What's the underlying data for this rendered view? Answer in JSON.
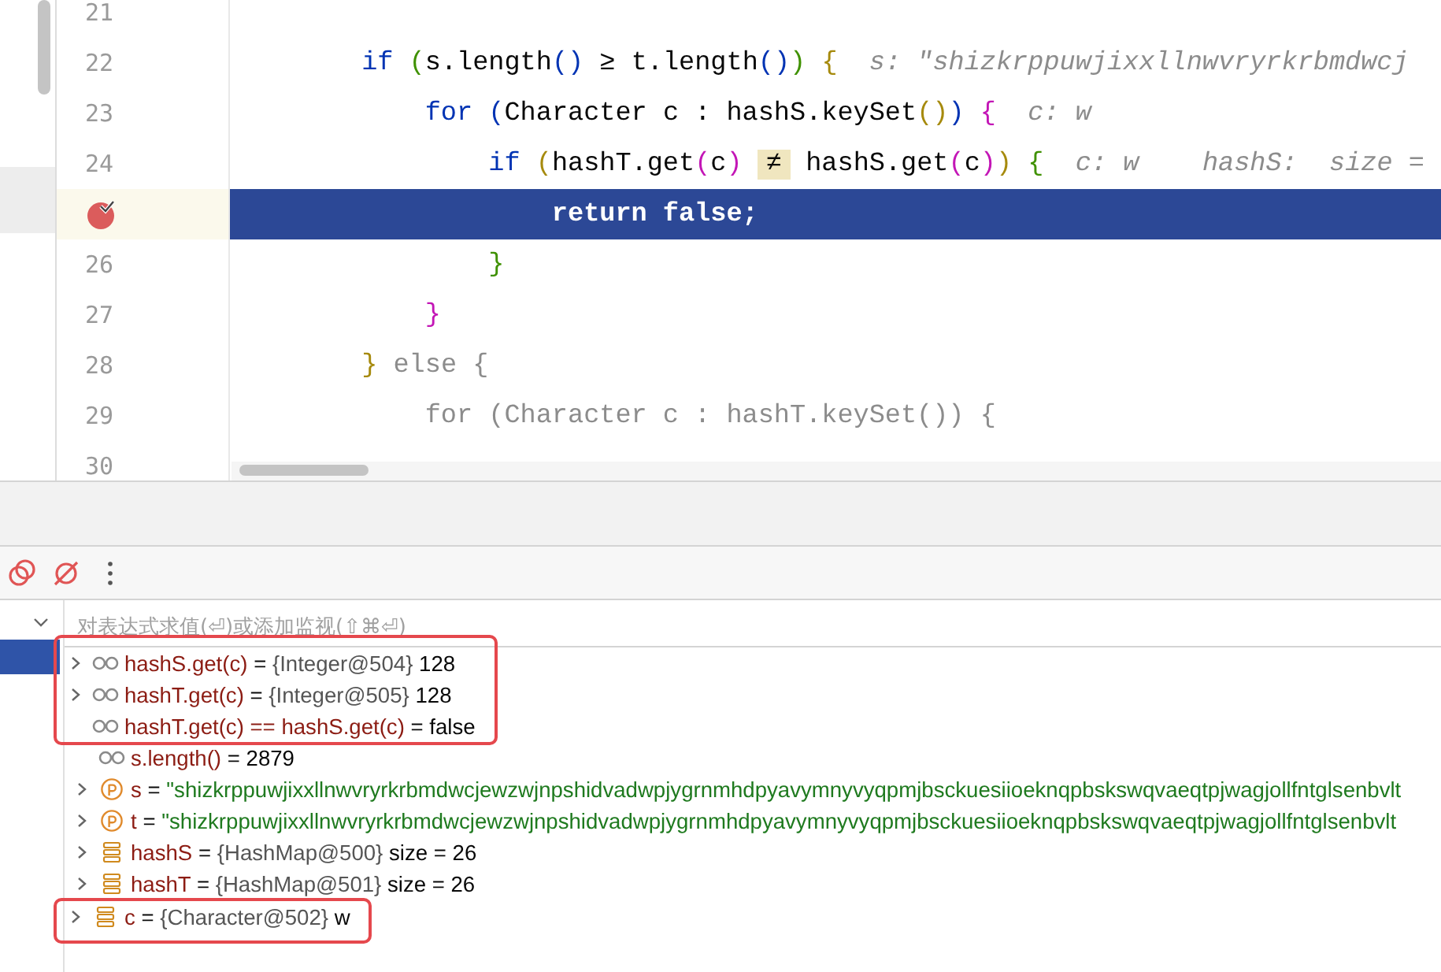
{
  "editor": {
    "lines": [
      {
        "number": "21",
        "breakpoint": false,
        "current": false
      },
      {
        "number": "22",
        "breakpoint": false,
        "current": false,
        "tokens": [
          {
            "text": "if ",
            "kind": "keyword"
          },
          {
            "text": "(",
            "kind": "paren-green"
          },
          {
            "text": "s.length",
            "kind": "plain"
          },
          {
            "text": "()",
            "kind": "paren-blue"
          },
          {
            "text": " ≥ t.length",
            "kind": "plain"
          },
          {
            "text": "()",
            "kind": "paren-blue"
          },
          {
            "text": ")",
            "kind": "paren-green"
          },
          {
            "text": " {",
            "kind": "paren-gold"
          }
        ],
        "hints": [
          "s: \"shizkrppuwjixxllnwvryrkrbmdwcj"
        ],
        "children": [
          {
            "number": "23",
            "breakpoint": false,
            "current": false,
            "tokens": [
              {
                "text": "for ",
                "kind": "keyword"
              },
              {
                "text": "(",
                "kind": "paren-blue"
              },
              {
                "text": "Character c : hashS.keySet",
                "kind": "plain"
              },
              {
                "text": "()",
                "kind": "paren-gold"
              },
              {
                "text": ")",
                "kind": "paren-blue"
              },
              {
                "text": " {",
                "kind": "paren-magenta"
              }
            ],
            "hints": [
              "c: w"
            ],
            "children": [
              {
                "number": "24",
                "breakpoint": false,
                "current": false,
                "tokens": [
                  {
                    "text": "if ",
                    "kind": "keyword"
                  },
                  {
                    "text": "(",
                    "kind": "paren-gold"
                  },
                  {
                    "text": "hashT.get",
                    "kind": "plain"
                  },
                  {
                    "text": "(",
                    "kind": "paren-magenta"
                  },
                  {
                    "text": "c",
                    "kind": "plain"
                  },
                  {
                    "text": ") ",
                    "kind": "paren-magenta"
                  },
                  {
                    "text": "≠",
                    "kind": "op-highlight"
                  },
                  {
                    "text": " hashS.get",
                    "kind": "plain"
                  },
                  {
                    "text": "(",
                    "kind": "paren-magenta"
                  },
                  {
                    "text": "c",
                    "kind": "plain"
                  },
                  {
                    "text": ")",
                    "kind": "paren-magenta"
                  },
                  {
                    "text": ")",
                    "kind": "paren-gold"
                  },
                  {
                    "text": " {",
                    "kind": "paren-green"
                  }
                ],
                "hints": [
                  "c: w",
                  "hashS:  size ="
                ],
                "children": [
                  {
                    "breakpoint": true,
                    "current": true,
                    "tokens": [
                      {
                        "text": "return false;",
                        "kind": "keyword"
                      }
                    ]
                  }
                ]
              },
              {
                "number": "26",
                "breakpoint": false,
                "current": false,
                "tokens": [
                  {
                    "text": "}",
                    "kind": "paren-green"
                  }
                ]
              }
            ]
          },
          {
            "number": "27",
            "breakpoint": false,
            "current": false,
            "tokens": [
              {
                "text": "}",
                "kind": "paren-magenta"
              }
            ]
          }
        ]
      },
      {
        "number": "28",
        "breakpoint": false,
        "current": false,
        "tokens": [
          {
            "text": "}",
            "kind": "paren-gold"
          },
          {
            "text": " else {",
            "kind": "dim"
          }
        ],
        "children": [
          {
            "number": "29",
            "breakpoint": false,
            "current": false,
            "tokens": [
              {
                "text": "for (Character c : hashT.keySet()) {",
                "kind": "dim"
              }
            ],
            "children": [
              {
                "number": "30",
                "breakpoint": false,
                "current": false
              }
            ]
          }
        ]
      }
    ]
  },
  "frames": {
    "expanded": true
  },
  "watch_field": {
    "placeholder": "对表达式求值(⏎)或添加监视(⇧⌘⏎)"
  },
  "watches": [
    {
      "expandable": true,
      "kind": "watch",
      "name": "hashS.get(c)",
      "operator": "=",
      "type": "{Integer@504}",
      "value": "128",
      "outlined": true
    },
    {
      "expandable": true,
      "kind": "watch",
      "name": "hashT.get(c)",
      "operator": "=",
      "type": "{Integer@505}",
      "value": "128",
      "outlined": true
    },
    {
      "expandable": false,
      "kind": "watch",
      "name": "hashT.get(c) == hashS.get(c)",
      "operator": "=",
      "value": "false",
      "outlined": true
    },
    {
      "expandable": false,
      "kind": "watch",
      "name": "s.length()",
      "operator": "=",
      "value": "2879",
      "outlined": false
    },
    {
      "expandable": true,
      "kind": "parameter",
      "name": "s",
      "operator": "=",
      "value": "\"shizkrppuwjixxllnwvryrkrbmdwcjewzwjnpshidvadwpjygrnmhdpyavymnyvyqpmjbsckuesiioeknqpbskswqvaeqtpjwagjollfntglsenbvlt",
      "outlined": false
    },
    {
      "expandable": true,
      "kind": "parameter",
      "name": "t",
      "operator": "=",
      "value": "\"shizkrppuwjixxllnwvryrkrbmdwcjewzwjnpshidvadwpjygrnmhdpyavymnyvyqpmjbsckuesiioeknqpbskswqvaeqtpjwagjollfntglsenbvlt",
      "outlined": false
    },
    {
      "expandable": true,
      "kind": "field",
      "name": "hashS",
      "operator": "=",
      "type": "{HashMap@500}",
      "value": "size = 26",
      "outlined": false
    },
    {
      "expandable": true,
      "kind": "field",
      "name": "hashT",
      "operator": "=",
      "type": "{HashMap@501}",
      "value": "size = 26",
      "outlined": false
    },
    {
      "expandable": true,
      "kind": "field",
      "name": "c",
      "operator": "=",
      "type": "{Character@502}",
      "value": "w",
      "outlined": true
    }
  ]
}
